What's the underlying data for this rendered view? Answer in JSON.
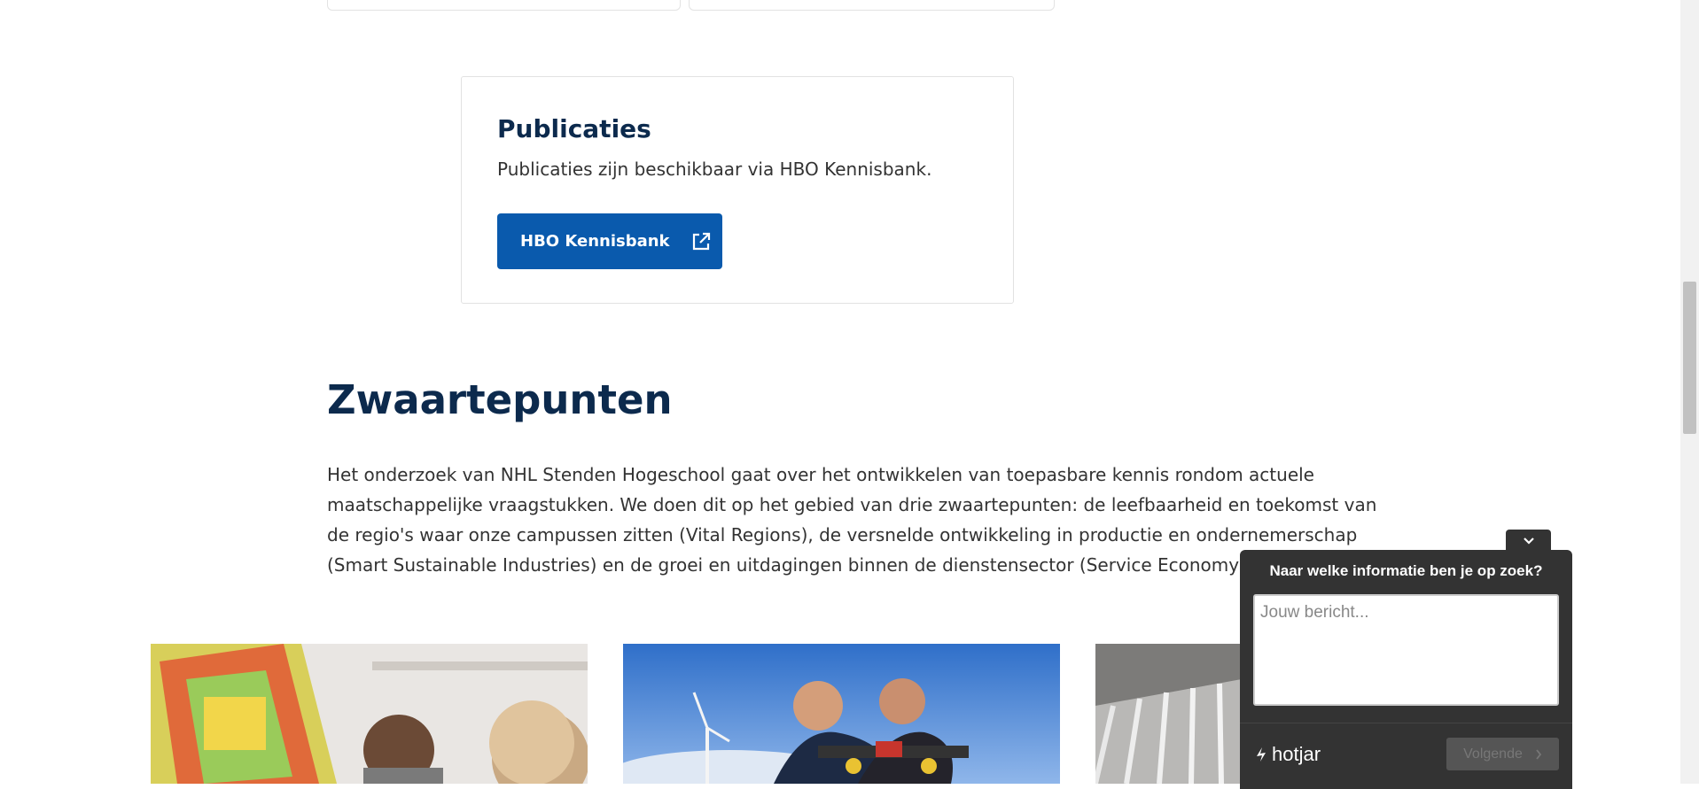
{
  "publicaties": {
    "title": "Publicaties",
    "description": "Publicaties zijn beschikbaar via HBO Kennisbank.",
    "button_label": "HBO Kennisbank"
  },
  "zwaartepunten": {
    "title": "Zwaartepunten",
    "text": "Het onderzoek van NHL Stenden Hogeschool gaat over het ontwikkelen van toepasbare kennis rondom actuele maatschappelijke vraagstukken. We doen dit op het gebied van drie zwaartepunten: de leefbaarheid en toekomst van de regio's waar onze campussen zitten (Vital Regions), de versnelde ontwikkeling in productie en ondernemerschap (Smart Sustainable Industries) en de groei en uitdagingen binnen de dienstensector (Service Economy)."
  },
  "hotjar": {
    "question": "Naar welke informatie ben je op zoek?",
    "placeholder": "Jouw bericht...",
    "logo_text": "hotjar",
    "next_label": "Volgende"
  },
  "colors": {
    "heading": "#0c2a4d",
    "button": "#0a5aad",
    "widget_bg": "#333333"
  }
}
